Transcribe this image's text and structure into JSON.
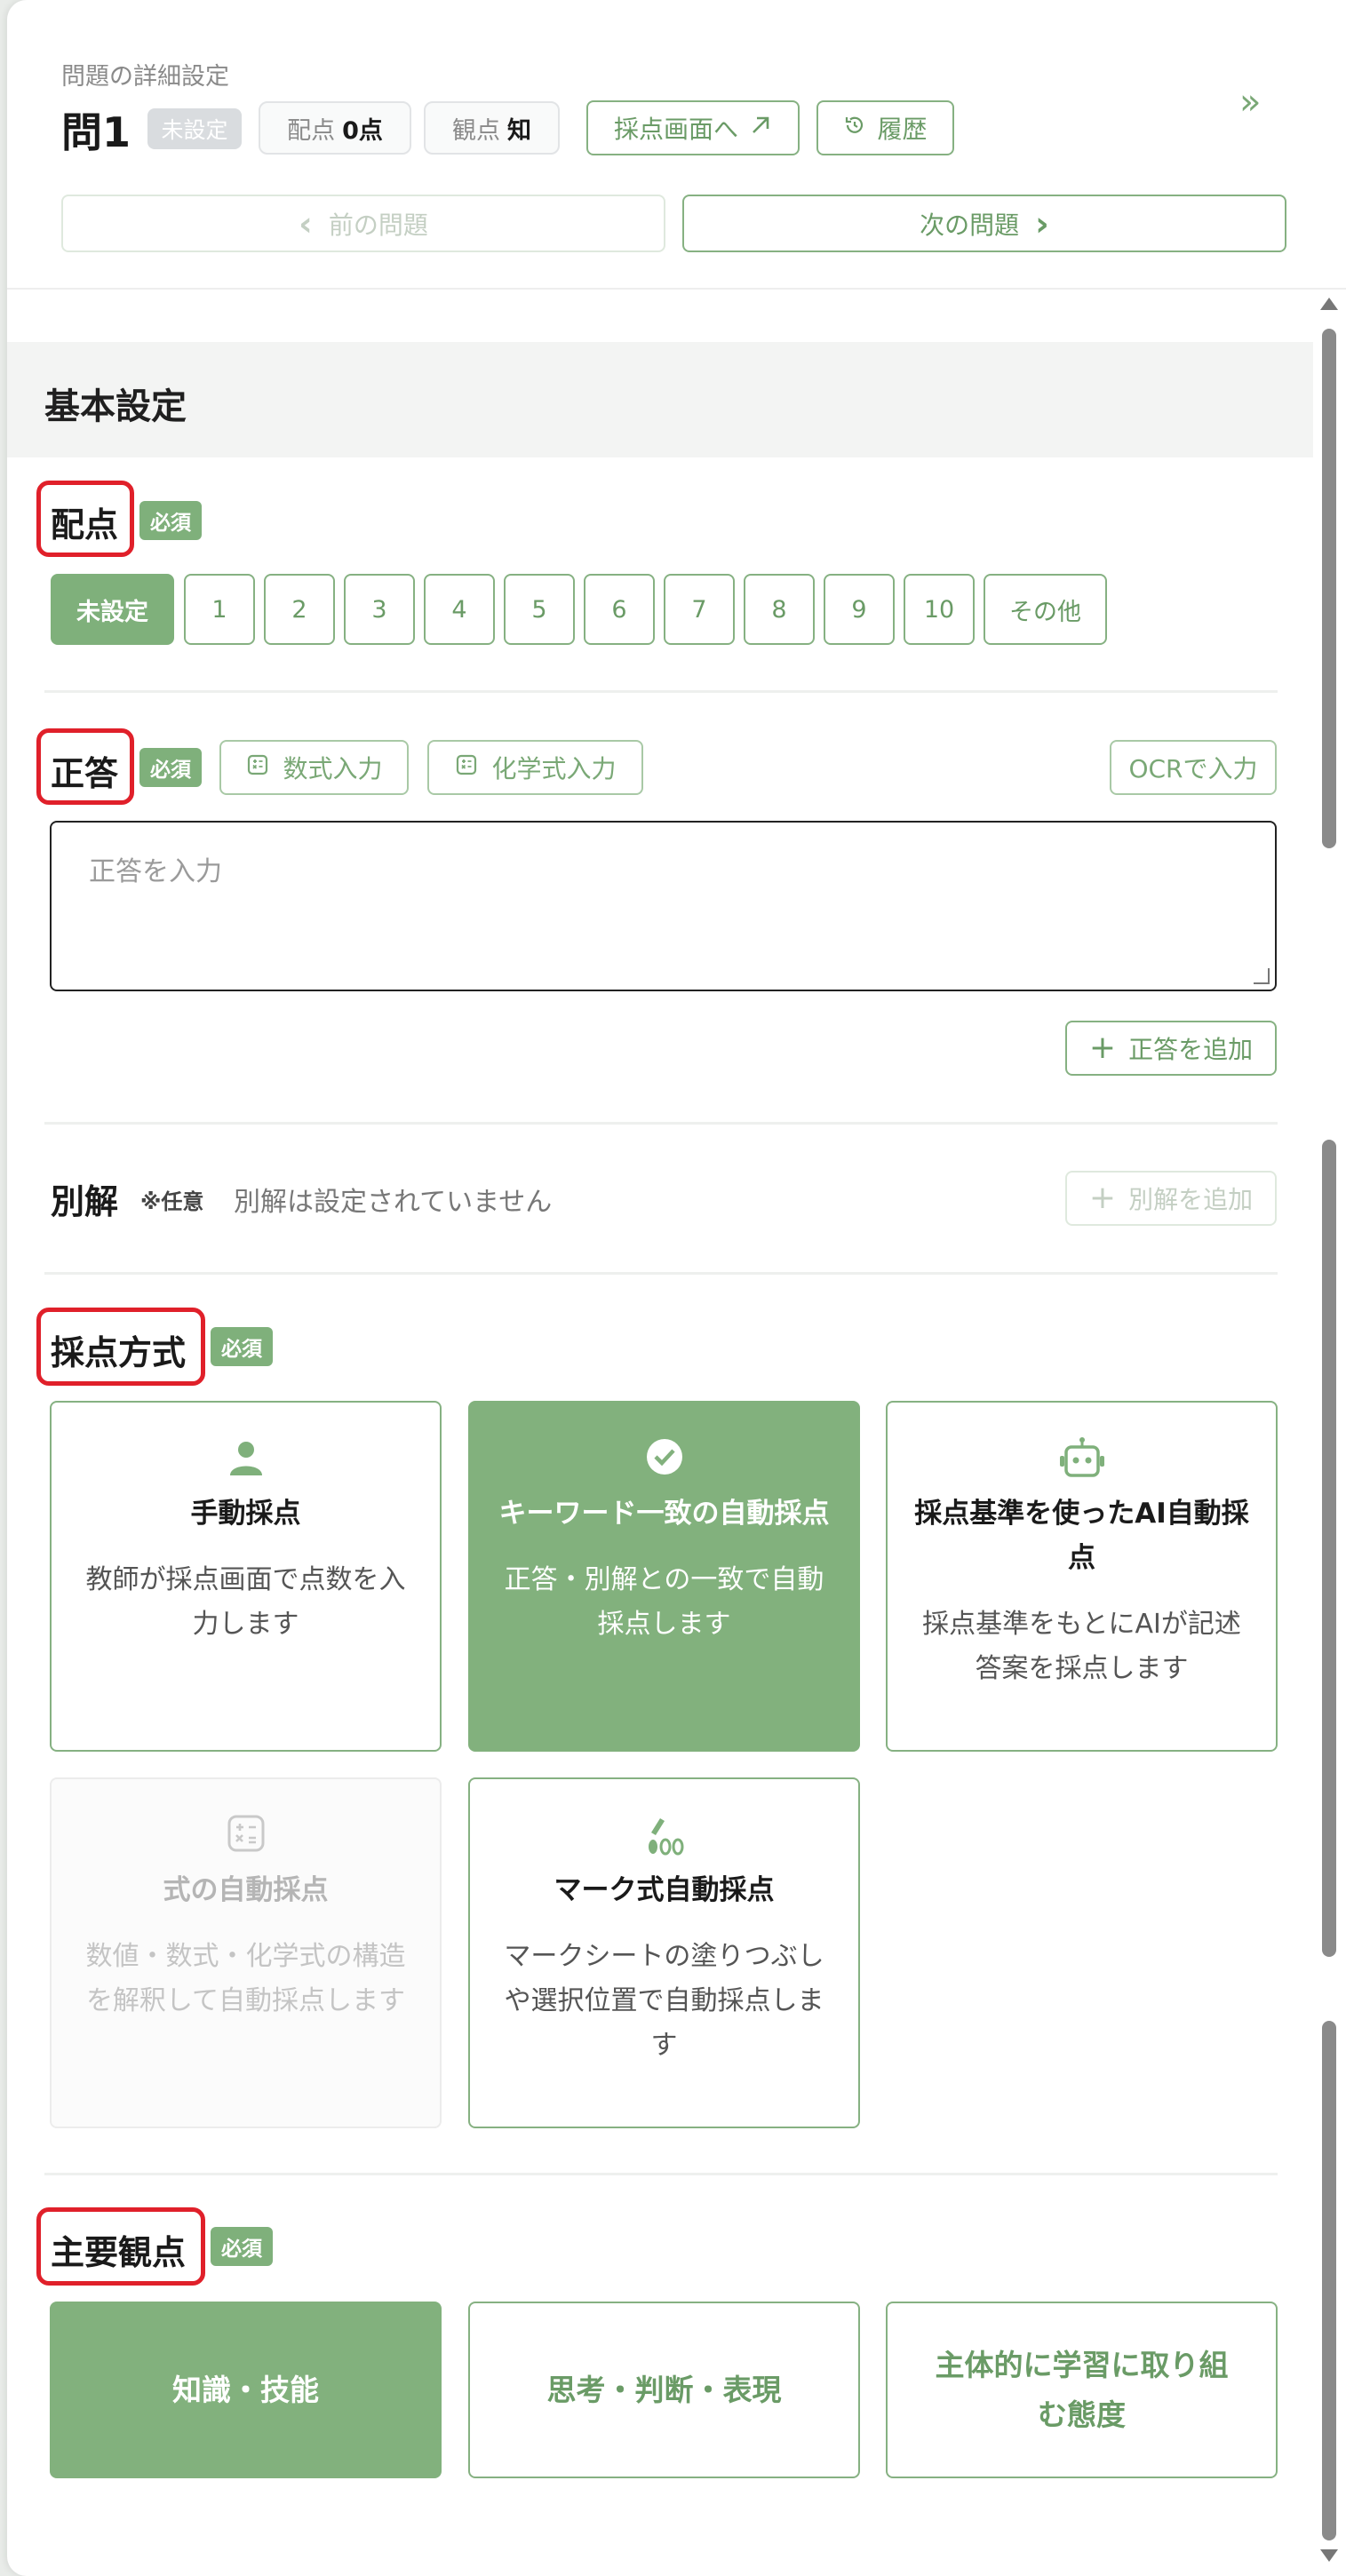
{
  "header": {
    "overline": "問題の詳細設定",
    "title": "問1",
    "status_badge": "未設定",
    "points_label": "配点",
    "points_value": "0点",
    "view_label": "観点",
    "view_value": "知",
    "scoring_screen_label": "採点画面へ",
    "history_label": "履歴",
    "prev_label": "前の問題",
    "next_label": "次の問題",
    "collapse_glyph": "»"
  },
  "basic": {
    "title": "基本設定",
    "required_badge": "必須",
    "points": {
      "label": "配点",
      "options": [
        "未設定",
        "1",
        "2",
        "3",
        "4",
        "5",
        "6",
        "7",
        "8",
        "9",
        "10",
        "その他"
      ],
      "selected": "未設定"
    },
    "answer": {
      "label": "正答",
      "math_input_label": "数式入力",
      "chem_input_label": "化学式入力",
      "ocr_label": "OCRで入力",
      "placeholder": "正答を入力",
      "add_label": "正答を追加"
    },
    "alternative": {
      "label": "別解",
      "optional_note": "※任意",
      "empty_text": "別解は設定されていません",
      "add_label": "別解を追加"
    },
    "scoring_method": {
      "label": "採点方式",
      "cards": [
        {
          "title": "手動採点",
          "desc": "教師が採点画面で点数を入力します",
          "icon": "person-icon"
        },
        {
          "title": "キーワード一致の自動採点",
          "desc": "正答・別解との一致で自動採点します",
          "icon": "check-circle-icon",
          "selected": true
        },
        {
          "title": "採点基準を使ったAI自動採点",
          "desc": "採点基準をもとにAIが記述答案を採点します",
          "icon": "robot-icon"
        },
        {
          "title": "式の自動採点",
          "desc": "数値・数式・化学式の構造を解釈して自動採点します",
          "icon": "calculator-icon",
          "disabled": true
        },
        {
          "title": "マーク式自動採点",
          "desc": "マークシートの塗りつぶしや選択位置で自動採点します",
          "icon": "pencil-marks-icon"
        }
      ]
    },
    "main_viewpoint": {
      "label": "主要観点",
      "options": [
        "知識・技能",
        "思考・判断・表現",
        "主体的に学習に取り組む態度"
      ],
      "selected": "知識・技能"
    }
  },
  "colors": {
    "accent": "#7fb07b",
    "accent_text": "#6a9b66",
    "highlight_box": "#e0202a"
  }
}
